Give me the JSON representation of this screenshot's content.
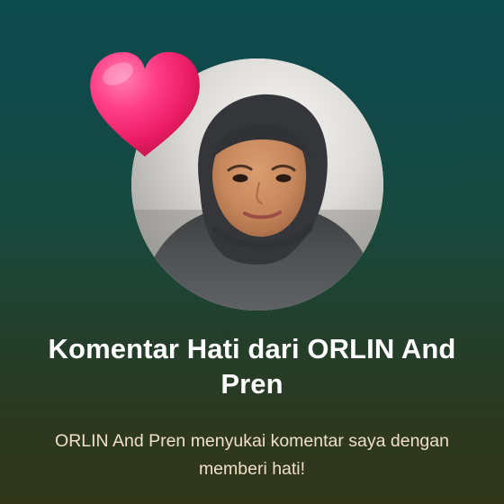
{
  "notification": {
    "title": "Komentar Hati dari ORLIN And Pren",
    "message": "ORLIN And Pren menyukai komentar saya dengan memberi hati!",
    "avatar_icon": "user-photo",
    "reaction_icon": "heart-icon"
  },
  "colors": {
    "background_top": "#0d4a4e",
    "background_bottom": "#31351a",
    "heart": "#f0206a",
    "title": "#ffffff",
    "message": "#f0dfc8"
  }
}
